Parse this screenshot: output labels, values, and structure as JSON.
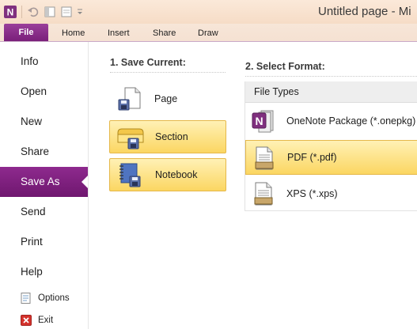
{
  "window": {
    "title": "Untitled page - Mi"
  },
  "ribbon": {
    "file_tab": "File",
    "tabs": [
      "Home",
      "Insert",
      "Share",
      "Draw"
    ]
  },
  "nav": {
    "items": [
      "Info",
      "Open",
      "New",
      "Share",
      "Save As",
      "Send",
      "Print",
      "Help"
    ],
    "active": "Save As",
    "small_items": [
      "Options",
      "Exit"
    ]
  },
  "save_current": {
    "heading": "1. Save Current:",
    "items": [
      "Page",
      "Section",
      "Notebook"
    ]
  },
  "select_format": {
    "heading": "2. Select Format:",
    "list_header": "File Types",
    "items": [
      "OneNote Package (*.onepkg)",
      "PDF (*.pdf)",
      "XPS (*.xps)"
    ],
    "selected": "PDF (*.pdf)"
  },
  "colors": {
    "accent_purple": "#7a1f7a",
    "highlight_yellow": "#fbd662",
    "titlebar": "#f6dcc6"
  },
  "icons": {
    "qat": [
      "onenote-logo-icon",
      "undo-icon",
      "dock-icon",
      "page-view-icon",
      "customize-chevron-icon"
    ],
    "save_items": [
      "page-save-icon",
      "section-save-icon",
      "notebook-save-icon"
    ],
    "format_items": [
      "onenote-package-icon",
      "pdf-document-icon",
      "xps-document-icon"
    ],
    "nav_small": [
      "options-icon",
      "exit-icon"
    ]
  }
}
